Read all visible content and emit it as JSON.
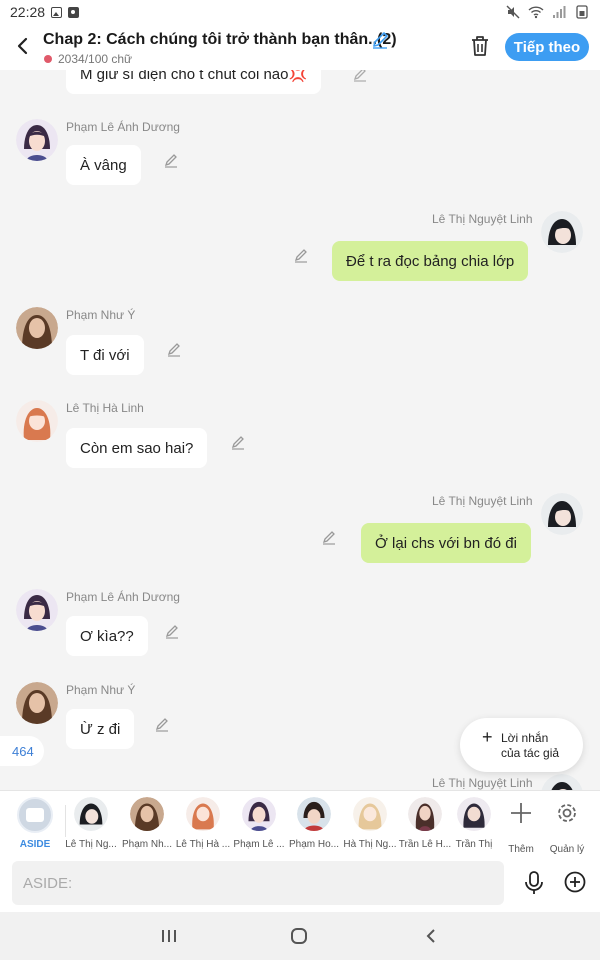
{
  "status_bar": {
    "time": "22:28"
  },
  "header": {
    "title": "Chap 2: Cách chúng tôi trở thành bạn thân..(2)",
    "word_count": "2034/100 chữ",
    "follow_label": "Tiếp theo"
  },
  "messages": [
    {
      "side": "left",
      "text": "M giữ sĩ diện cho t chút coi nào💢"
    },
    {
      "side": "left",
      "name": "Phạm Lê Ánh Dương",
      "text": "À vâng"
    },
    {
      "side": "right",
      "name": "Lê Thị Nguyệt Linh",
      "text": "Để t ra đọc bảng chia lớp"
    },
    {
      "side": "left",
      "name": "Phạm Như Ý",
      "text": "T đi với"
    },
    {
      "side": "left",
      "name": "Lê Thị Hà Linh",
      "text": "Còn em sao hai?"
    },
    {
      "side": "right",
      "name": "Lê Thị Nguyệt Linh",
      "text": "Ở lại chs với bn đó đi"
    },
    {
      "side": "left",
      "name": "Phạm Lê Ánh Dương",
      "text": "Ơ kìa??"
    },
    {
      "side": "left",
      "name": "Phạm Như Ý",
      "text": "Ừ z đi"
    },
    {
      "side": "right",
      "name": "Lê Thị Nguyệt Linh"
    }
  ],
  "count_badge": "464",
  "author_note": {
    "line1": "Lời nhắn",
    "line2": "của tác giả"
  },
  "characters": [
    {
      "label": "ASIDE"
    },
    {
      "label": "Lê Thị Ng..."
    },
    {
      "label": "Phạm Nh..."
    },
    {
      "label": "Lê Thị Hà ..."
    },
    {
      "label": "Phạm Lê ..."
    },
    {
      "label": "Phạm Ho..."
    },
    {
      "label": "Hà Thị Ng..."
    },
    {
      "label": "Trần Lê H..."
    },
    {
      "label": "Trần Thị"
    }
  ],
  "actions": {
    "add_label": "Thêm",
    "manage_label": "Quản lý"
  },
  "input": {
    "placeholder": "ASIDE:"
  },
  "colors": {
    "accent": "#3d9df2",
    "right_bubble": "#d4f09a",
    "left_bubble": "#ffffff",
    "background": "#f4f4f4"
  }
}
